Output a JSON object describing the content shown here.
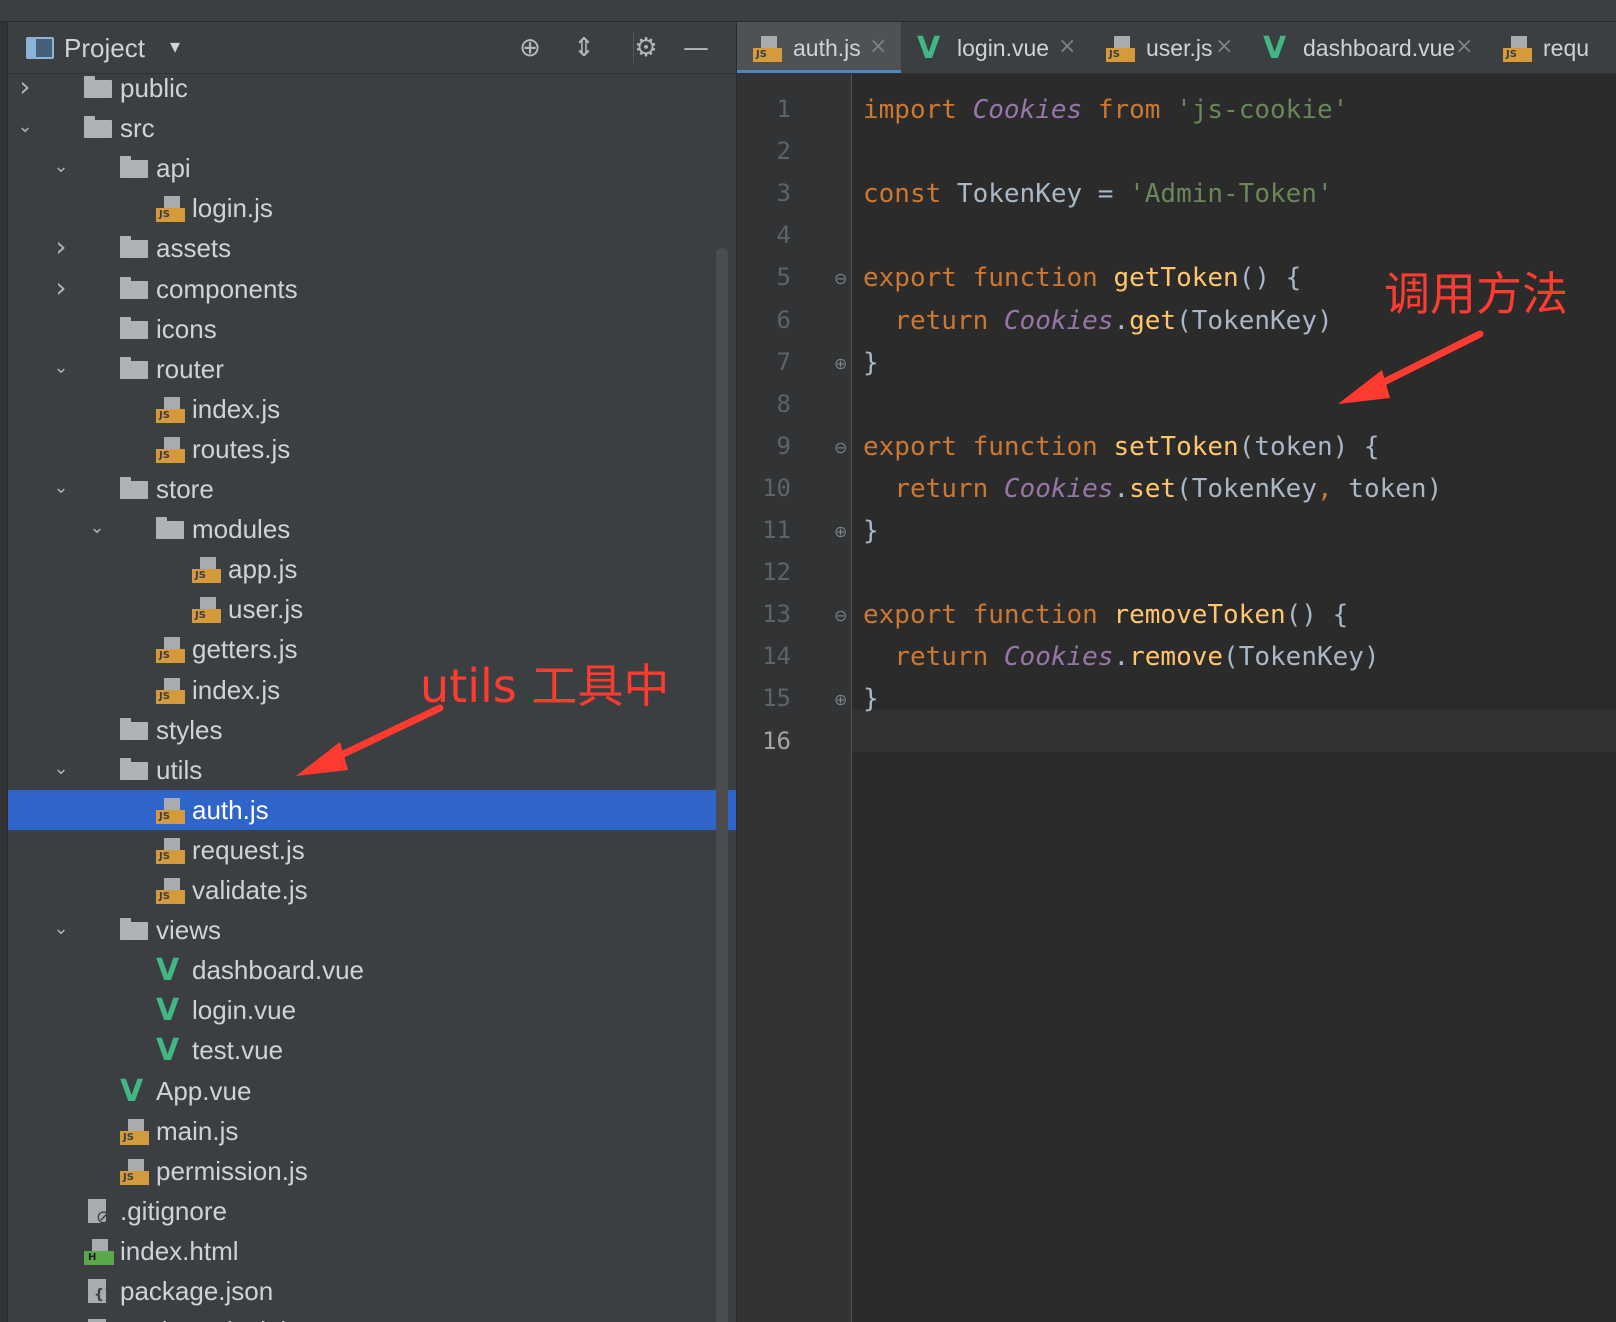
{
  "project_panel": {
    "title": "Project",
    "icons": [
      "project-view-icon",
      "dropdown-chevron-icon",
      "locate-target-icon",
      "collapse-all-icon",
      "gear-icon",
      "minimize-icon"
    ]
  },
  "tree": [
    {
      "label": "public",
      "type": "folder",
      "depth": 1,
      "expanded": false
    },
    {
      "label": "src",
      "type": "folder",
      "depth": 1,
      "expanded": true
    },
    {
      "label": "api",
      "type": "folder",
      "depth": 2,
      "expanded": true
    },
    {
      "label": "login.js",
      "type": "js",
      "depth": 3
    },
    {
      "label": "assets",
      "type": "folder",
      "depth": 2,
      "expanded": false
    },
    {
      "label": "components",
      "type": "folder",
      "depth": 2,
      "expanded": false
    },
    {
      "label": "icons",
      "type": "folder",
      "depth": 2,
      "expanded": null
    },
    {
      "label": "router",
      "type": "folder",
      "depth": 2,
      "expanded": true
    },
    {
      "label": "index.js",
      "type": "js",
      "depth": 3
    },
    {
      "label": "routes.js",
      "type": "js",
      "depth": 3
    },
    {
      "label": "store",
      "type": "folder",
      "depth": 2,
      "expanded": true
    },
    {
      "label": "modules",
      "type": "folder",
      "depth": 3,
      "expanded": true
    },
    {
      "label": "app.js",
      "type": "js",
      "depth": 4
    },
    {
      "label": "user.js",
      "type": "js",
      "depth": 4
    },
    {
      "label": "getters.js",
      "type": "js",
      "depth": 3
    },
    {
      "label": "index.js",
      "type": "js",
      "depth": 3
    },
    {
      "label": "styles",
      "type": "folder",
      "depth": 2,
      "expanded": null
    },
    {
      "label": "utils",
      "type": "folder",
      "depth": 2,
      "expanded": true
    },
    {
      "label": "auth.js",
      "type": "js",
      "depth": 3,
      "selected": true
    },
    {
      "label": "request.js",
      "type": "js",
      "depth": 3
    },
    {
      "label": "validate.js",
      "type": "js",
      "depth": 3
    },
    {
      "label": "views",
      "type": "folder",
      "depth": 2,
      "expanded": true
    },
    {
      "label": "dashboard.vue",
      "type": "vue",
      "depth": 3
    },
    {
      "label": "login.vue",
      "type": "vue",
      "depth": 3
    },
    {
      "label": "test.vue",
      "type": "vue",
      "depth": 3
    },
    {
      "label": "App.vue",
      "type": "vue",
      "depth": 2
    },
    {
      "label": "main.js",
      "type": "js",
      "depth": 2
    },
    {
      "label": "permission.js",
      "type": "js",
      "depth": 2
    },
    {
      "label": ".gitignore",
      "type": "git",
      "depth": 1
    },
    {
      "label": "index.html",
      "type": "html",
      "depth": 1
    },
    {
      "label": "package.json",
      "type": "json",
      "depth": 1
    },
    {
      "label": "package-lock.json",
      "type": "json",
      "depth": 1
    }
  ],
  "tabs": [
    {
      "label": "auth.js",
      "type": "js",
      "active": true
    },
    {
      "label": "login.vue",
      "type": "vue",
      "active": false
    },
    {
      "label": "user.js",
      "type": "js",
      "active": false
    },
    {
      "label": "dashboard.vue",
      "type": "vue",
      "active": false
    },
    {
      "label": "requ",
      "type": "js",
      "active": false
    }
  ],
  "editor": {
    "current_line": 16,
    "lines": [
      [
        [
          "kw",
          "import "
        ],
        [
          "cls",
          "Cookies "
        ],
        [
          "kw",
          "from "
        ],
        [
          "str",
          "'js-cookie'"
        ]
      ],
      [],
      [
        [
          "kw",
          "const "
        ],
        [
          "plain",
          "TokenKey = "
        ],
        [
          "str",
          "'Admin-Token'"
        ]
      ],
      [],
      [
        [
          "kw",
          "export function "
        ],
        [
          "fn",
          "getToken"
        ],
        [
          "plain",
          "() {"
        ]
      ],
      [
        [
          "plain",
          "  "
        ],
        [
          "kw",
          "return "
        ],
        [
          "cls",
          "Cookies"
        ],
        [
          "plain",
          "."
        ],
        [
          "fn",
          "get"
        ],
        [
          "plain",
          "(TokenKey)"
        ]
      ],
      [
        [
          "plain",
          "}"
        ]
      ],
      [],
      [
        [
          "kw",
          "export function "
        ],
        [
          "fn",
          "setToken"
        ],
        [
          "plain",
          "(token) {"
        ]
      ],
      [
        [
          "plain",
          "  "
        ],
        [
          "kw",
          "return "
        ],
        [
          "cls",
          "Cookies"
        ],
        [
          "plain",
          "."
        ],
        [
          "fn",
          "set"
        ],
        [
          "plain",
          "(TokenKey"
        ],
        [
          "kw",
          ", "
        ],
        [
          "plain",
          "token)"
        ]
      ],
      [
        [
          "plain",
          "}"
        ]
      ],
      [],
      [
        [
          "kw",
          "export function "
        ],
        [
          "fn",
          "removeToken"
        ],
        [
          "plain",
          "() {"
        ]
      ],
      [
        [
          "plain",
          "  "
        ],
        [
          "kw",
          "return "
        ],
        [
          "cls",
          "Cookies"
        ],
        [
          "plain",
          "."
        ],
        [
          "fn",
          "remove"
        ],
        [
          "plain",
          "(TokenKey)"
        ]
      ],
      [
        [
          "plain",
          "}"
        ]
      ],
      []
    ]
  },
  "annotations": {
    "utils_note": "utils 工具中",
    "method_note": "调用方法"
  },
  "colors": {
    "keyword": "#cc7832",
    "class": "#9876aa",
    "function": "#ffc66d",
    "string": "#6a8759",
    "selection": "#2f65ca",
    "annotation": "#ff3b30"
  }
}
